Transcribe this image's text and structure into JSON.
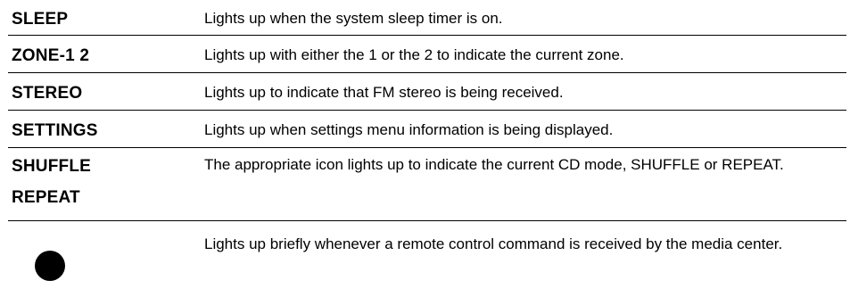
{
  "rows": [
    {
      "term": "SLEEP",
      "desc": "Lights up when the system sleep timer is on."
    },
    {
      "term": "ZONE-1 2",
      "desc": "Lights up with either the 1 or the 2 to indicate the current zone."
    },
    {
      "term": "STEREO",
      "desc": "Lights up to indicate that FM stereo is being received."
    },
    {
      "term": "SETTINGS",
      "desc": "Lights up when settings menu information is being displayed."
    },
    {
      "term1": "SHUFFLE",
      "term2": "REPEAT",
      "desc": "The appropriate icon lights up to indicate the current CD mode, SHUFFLE or REPEAT."
    },
    {
      "icon": "filled-circle-icon",
      "desc": "Lights up briefly whenever a remote control command is received by the media center."
    }
  ]
}
